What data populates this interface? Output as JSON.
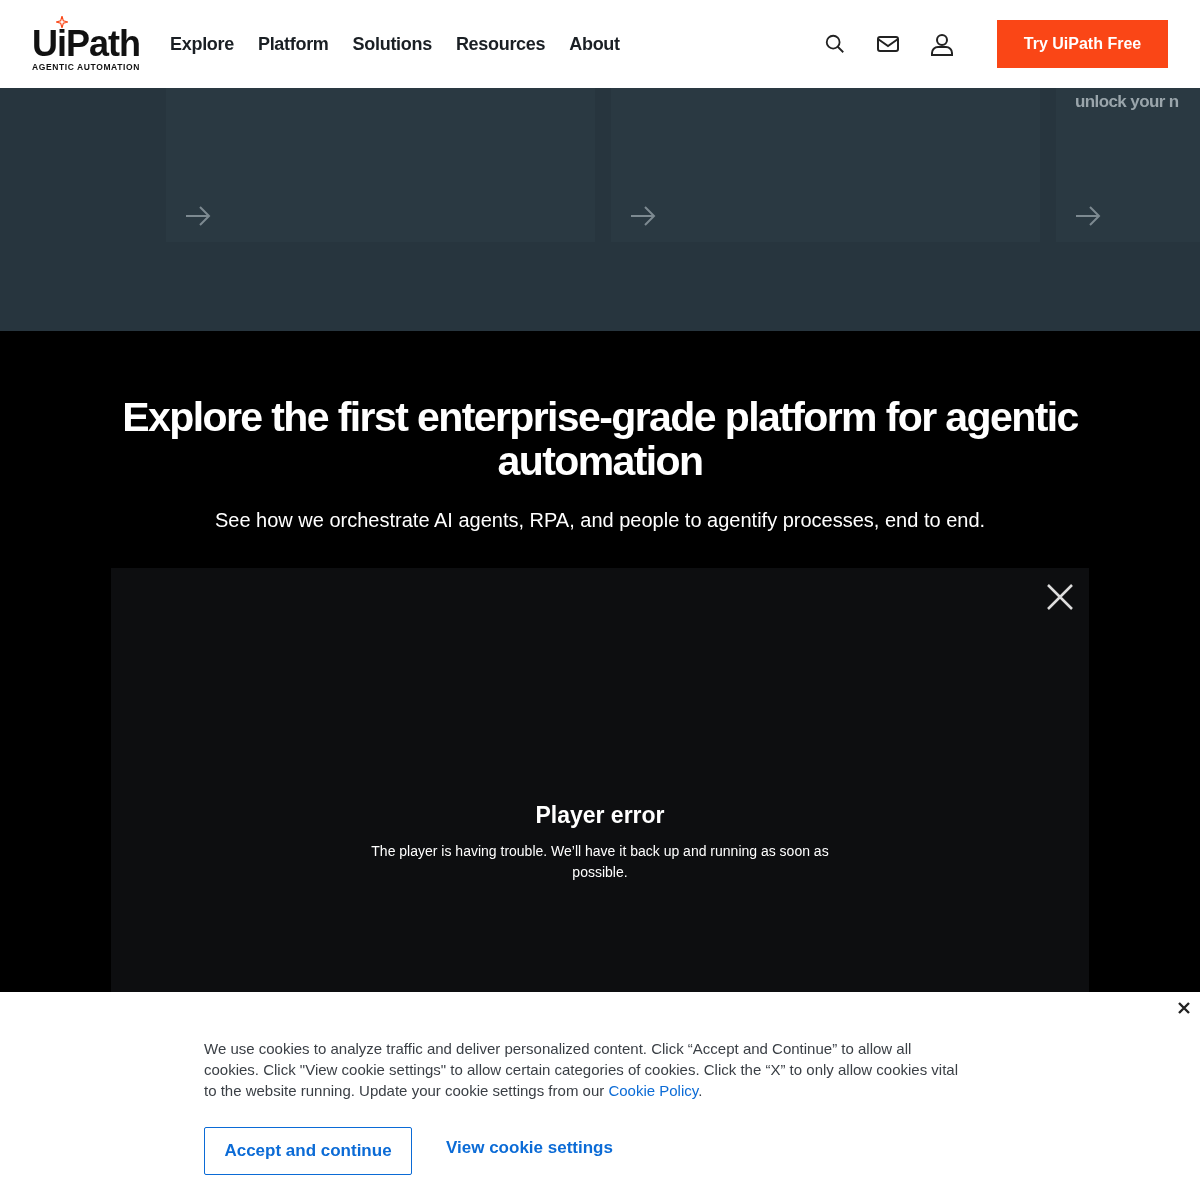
{
  "header": {
    "logo": {
      "wordmark": "UiPath",
      "tagline": "AGENTIC AUTOMATION"
    },
    "nav": [
      "Explore",
      "Platform",
      "Solutions",
      "Resources",
      "About"
    ],
    "cta": "Try UiPath Free"
  },
  "cards": [
    {
      "kind": "link"
    },
    {
      "kind": "link"
    },
    {
      "kind": "link",
      "text": "unlock your n"
    }
  ],
  "hero": {
    "title": "Explore the first enterprise-grade platform for agentic automation",
    "subtitle": "See how we orchestrate AI agents, RPA, and people to agentify processes, end to end."
  },
  "player": {
    "title": "Player error",
    "message": "The player is having trouble. We’ll have it back up and running as soon as possible."
  },
  "cookie_banner": {
    "text": "We use cookies to analyze traffic and deliver personalized content. Click “Accept and Continue” to allow all cookies. Click \"View cookie settings\" to allow certain categories of cookies. Click the “X” to only allow cookies vital to the website running. Update your cookie settings from our ",
    "link": "Cookie Policy",
    "after": ".",
    "accept": "Accept and continue",
    "settings": "View cookie settings"
  }
}
